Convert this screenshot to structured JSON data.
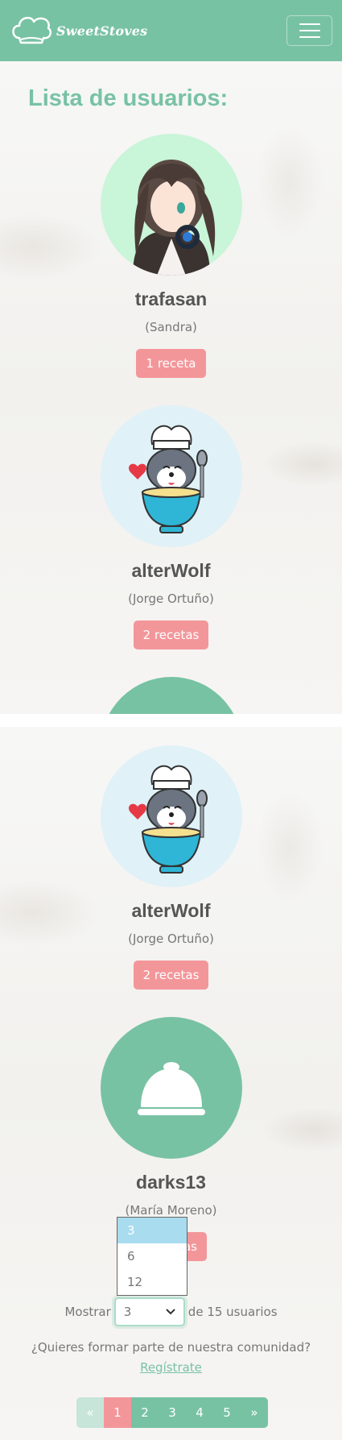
{
  "brand": {
    "name": "SweetStoves"
  },
  "page": {
    "title": "Lista de usuarios:"
  },
  "users_top": [
    {
      "username": "trafasan",
      "realname": "(Sandra)",
      "recipes": "1 receta",
      "avatar": "anime-girl"
    },
    {
      "username": "alterWolf",
      "realname": "(Jorge Ortuño)",
      "recipes": "2 recetas",
      "avatar": "wolf-chef"
    }
  ],
  "users_bottom": [
    {
      "username": "alterWolf",
      "realname": "(Jorge Ortuño)",
      "recipes": "2 recetas",
      "avatar": "wolf-chef"
    },
    {
      "username": "darks13",
      "realname": "(María Moreno)",
      "recipes": "as",
      "avatar": "cloche"
    }
  ],
  "pager_size": {
    "label": "Mostrar",
    "selected": "3",
    "options": [
      "3",
      "6",
      "12"
    ],
    "suffix": "de 15 usuarios"
  },
  "join": {
    "question": "¿Quieres formar parte de nuestra comunidad?",
    "link": "Regístrate"
  },
  "pagination": {
    "prev": "«",
    "pages": [
      "1",
      "2",
      "3",
      "4",
      "5"
    ],
    "next": "»",
    "active": "1"
  },
  "colors": {
    "primary": "#78c2a4",
    "secondary": "#f3969a",
    "text": "#777777"
  }
}
